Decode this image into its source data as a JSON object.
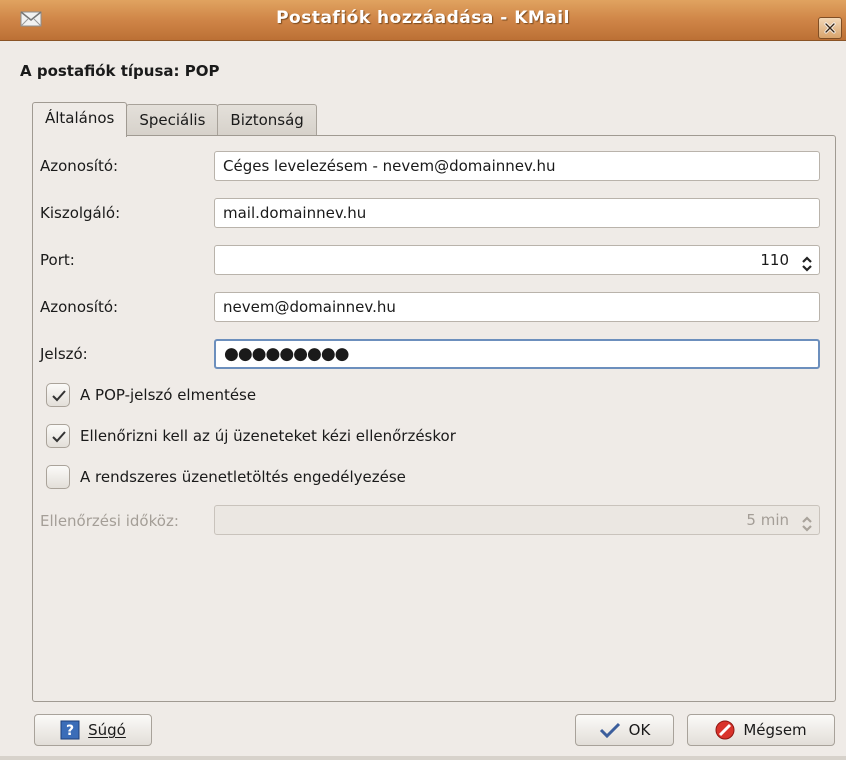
{
  "window": {
    "title": "Postafiók hozzáadása - KMail"
  },
  "heading": "A postafiók típusa: POP",
  "tabs": [
    {
      "label": "Általános",
      "active": true
    },
    {
      "label": "Speciális",
      "active": false
    },
    {
      "label": "Biztonság",
      "active": false
    }
  ],
  "form": {
    "identity": {
      "label": "Azonosító:",
      "value": "Céges levelezésem - nevem@domainnev.hu"
    },
    "server": {
      "label": "Kiszolgáló:",
      "value": "mail.domainnev.hu"
    },
    "port": {
      "label": "Port:",
      "value": "110"
    },
    "username": {
      "label": "Azonosító:",
      "value": "nevem@domainnev.hu"
    },
    "password": {
      "label": "Jelszó:",
      "value": "●●●●●●●●●"
    },
    "save_password": {
      "label": "A POP-jelszó elmentése",
      "checked": true
    },
    "manual_check": {
      "label": "Ellenőrizni kell az új üzeneteket kézi ellenőrzéskor",
      "checked": true
    },
    "interval_enabled": {
      "label": "A rendszeres üzenetletöltés engedélyezése",
      "checked": false
    },
    "interval": {
      "label": "Ellenőrzési időköz:",
      "value": "5 min",
      "disabled": true
    }
  },
  "buttons": {
    "help": "Súgó",
    "ok": "OK",
    "cancel": "Mégsem"
  },
  "colors": {
    "titlebar": "#cf8547",
    "focus_border": "#6c8fbd",
    "background": "#efebe7"
  },
  "icons": {
    "window": "kmail-app-icon",
    "close": "close-icon",
    "help": "help-book-icon",
    "ok": "checkmark-icon",
    "cancel": "cancel-icon"
  }
}
